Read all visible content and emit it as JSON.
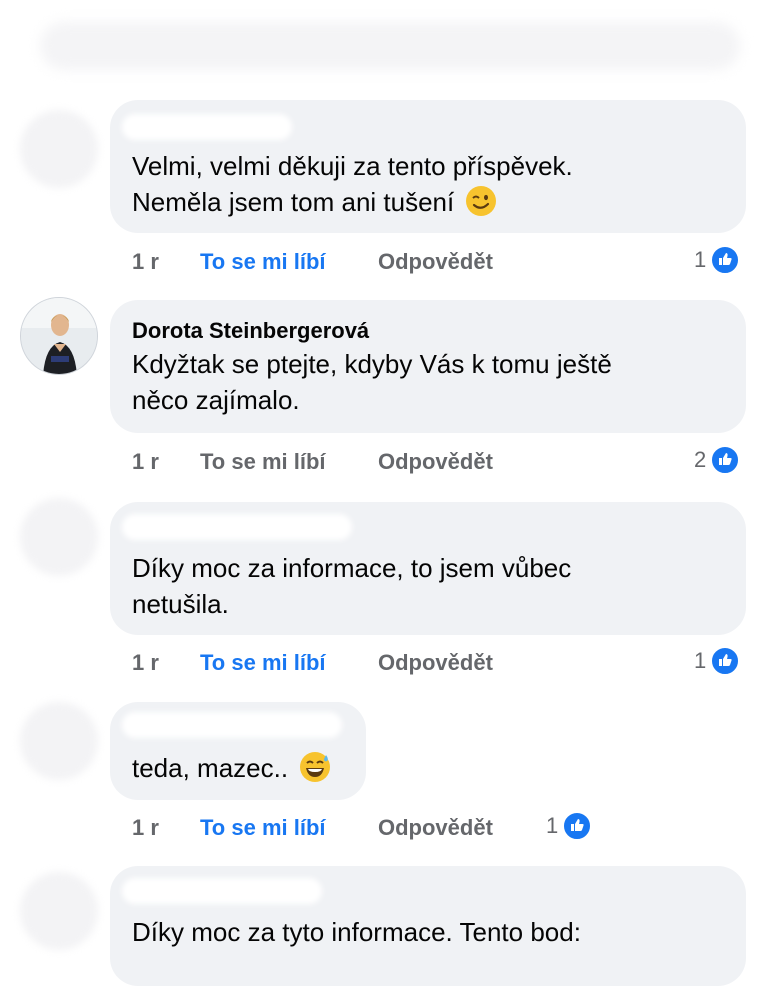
{
  "comments": [
    {
      "author": "",
      "text_lines": [
        "Velmi, velmi děkuji za tento příspěvek.",
        "Neměla jsem tom ani tušení"
      ],
      "emoji": "winking-face",
      "time": "1 r",
      "like_label": "To se mi líbí",
      "like_active": true,
      "reply_label": "Odpovědět",
      "reaction_count": "1"
    },
    {
      "author": "Dorota Steinbergerová",
      "text_lines": [
        "Kdyžtak se ptejte, kdyby Vás k tomu ještě",
        "něco zajímalo."
      ],
      "time": "1 r",
      "like_label": "To se mi líbí",
      "like_active": false,
      "reply_label": "Odpovědět",
      "reaction_count": "2"
    },
    {
      "author": "",
      "text_lines": [
        "Díky moc za informace, to jsem vůbec",
        "netušila."
      ],
      "time": "1 r",
      "like_label": "To se mi líbí",
      "like_active": true,
      "reply_label": "Odpovědět",
      "reaction_count": "1"
    },
    {
      "author": "",
      "text_lines": [
        "teda, mazec.."
      ],
      "emoji": "grinning-sweat-face",
      "time": "1 r",
      "like_label": "To se mi líbí",
      "like_active": true,
      "reply_label": "Odpovědět",
      "reaction_count": "1"
    },
    {
      "author": "",
      "text_lines": [
        "Díky moc za tyto informace. Tento bod:"
      ]
    }
  ],
  "colors": {
    "accent": "#1877f2",
    "bubble": "#f0f2f5",
    "muted": "#65676b",
    "text": "#050505"
  },
  "icons": {
    "reaction": "like-thumb-icon"
  }
}
